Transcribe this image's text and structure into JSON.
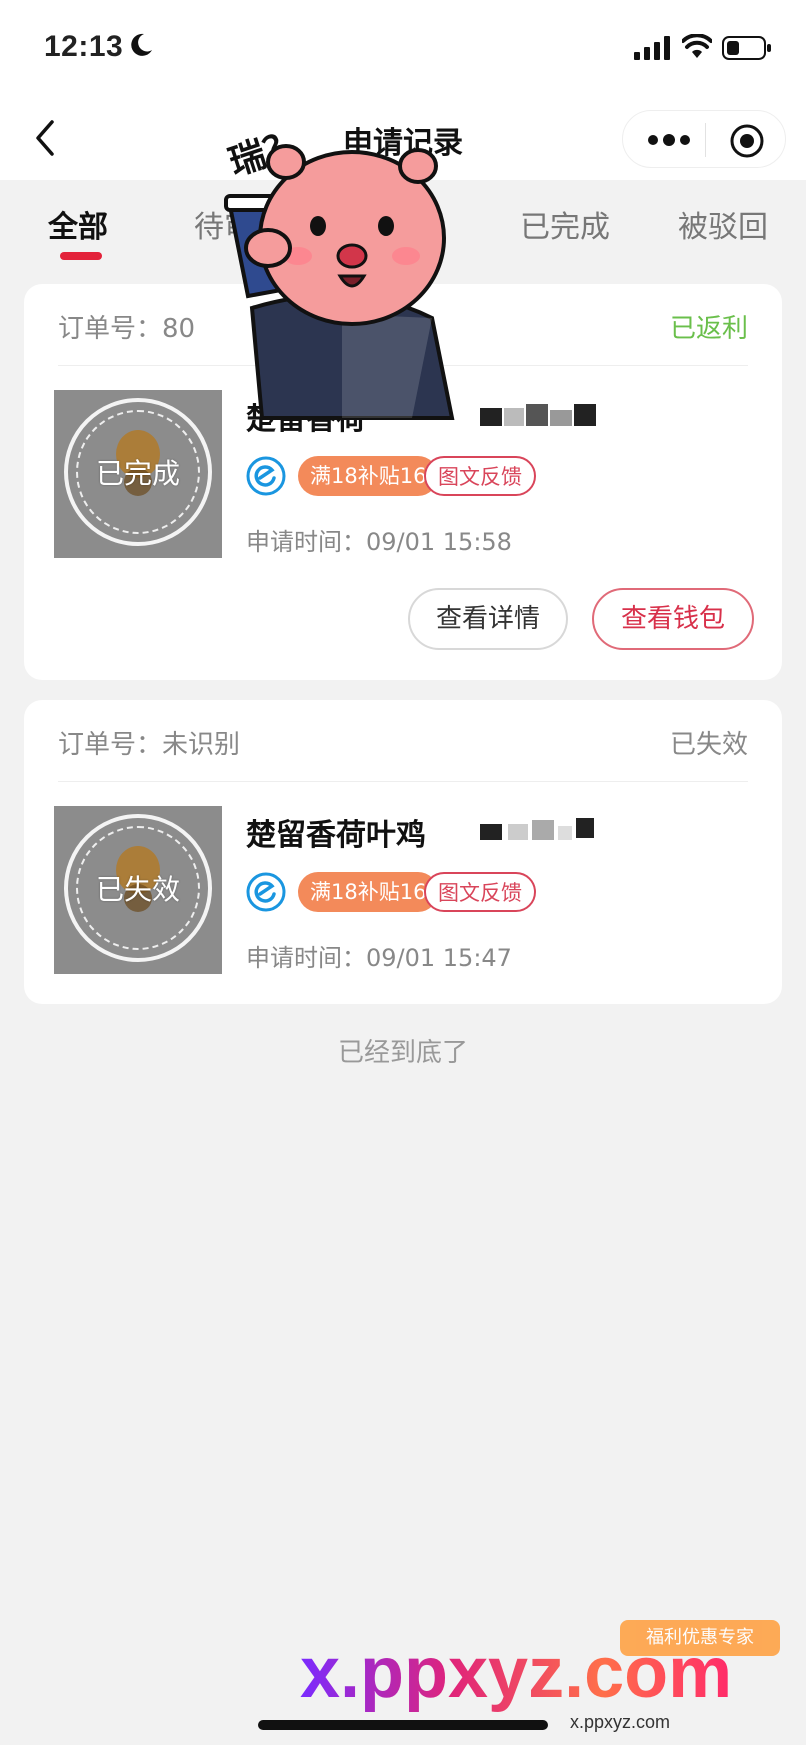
{
  "status_bar": {
    "time": "12:13"
  },
  "nav": {
    "title": "申请记录"
  },
  "tabs": [
    {
      "label": "全部"
    },
    {
      "label": "待审核"
    },
    {
      "label": "已完成"
    },
    {
      "label": "被驳回"
    }
  ],
  "orders": [
    {
      "order_label": "订单号：80",
      "status": "已返利",
      "status_color": "#6abf4b",
      "stamp": "已完成",
      "shop_name": "楚留香荷",
      "subsidy_tag": "满18补贴16",
      "feedback_tag": "图文反馈",
      "apply_time": "申请时间：09/01 15:58",
      "buttons": {
        "detail": "查看详情",
        "wallet": "查看钱包"
      }
    },
    {
      "order_label": "订单号：未识别",
      "status": "已失效",
      "status_color": "#888888",
      "stamp": "已失效",
      "shop_name": "楚留香荷叶鸡",
      "subsidy_tag": "满18补贴16",
      "feedback_tag": "图文反馈",
      "apply_time": "申请时间：09/01 15:47"
    }
  ],
  "footer": {
    "end_text": "已经到底了"
  },
  "overlay": {
    "sticker_text": "瑞？",
    "watermark": "x.ppxyz.com",
    "watermark_small": "x.ppxyz.com",
    "badge_text": "福利优惠专家"
  },
  "colors": {
    "accent": "#e3223a",
    "subsidy": "#f38a5a",
    "feedback": "#d9455a"
  }
}
